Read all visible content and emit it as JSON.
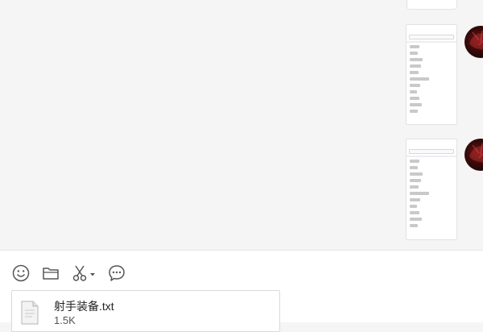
{
  "toolbar": {
    "emoji_icon": "smiley-icon",
    "folder_icon": "folder-icon",
    "screenshot_icon": "scissors-icon",
    "screenshot_dropdown_icon": "caret-down-icon",
    "chat_record_icon": "speech-bubble-icon"
  },
  "attachment": {
    "file_name": "射手装备.txt",
    "file_size": "1.5K",
    "icon": "text-file-icon"
  },
  "colors": {
    "chat_background": "#f5f5f5",
    "input_background": "#ffffff",
    "icon_stroke": "#555555",
    "avatar_red": "#7a1c1c"
  }
}
